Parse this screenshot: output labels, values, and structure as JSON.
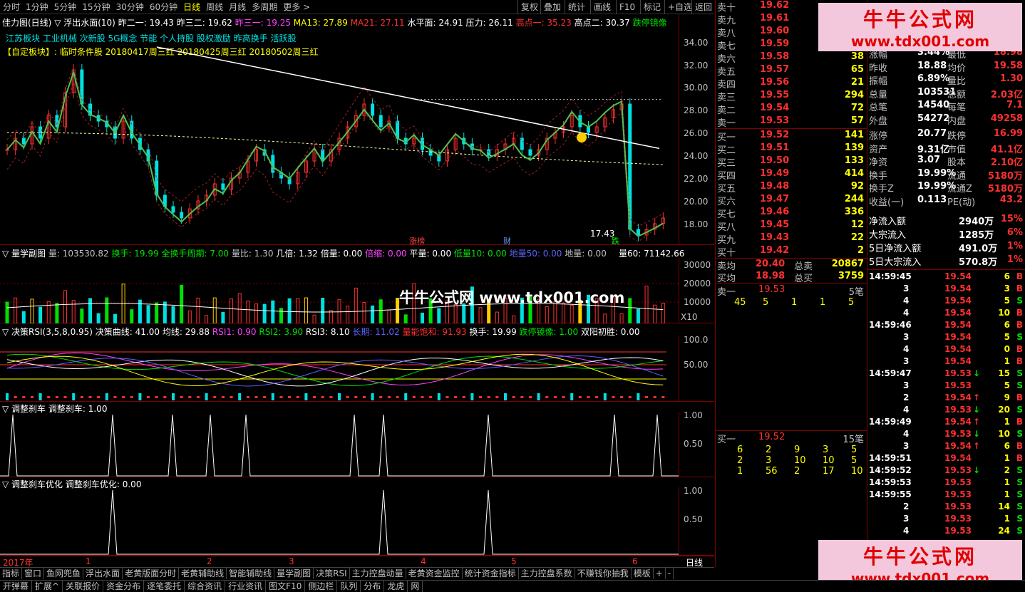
{
  "toolbar": {
    "periods": [
      "分时",
      "1分钟",
      "5分钟",
      "15分钟",
      "30分钟",
      "60分钟",
      "日线",
      "周线",
      "月线",
      "多周期",
      "更多 >"
    ],
    "buttons": [
      "复权",
      "叠加",
      "统计",
      "画线",
      "F10",
      "标记",
      "+自选",
      "返回"
    ]
  },
  "main": {
    "title": "佳力图(日线)",
    "indicator": "▽ 浮出水面(10)",
    "vals": [
      [
        "昨二一: 19.43",
        "wht"
      ],
      [
        "昨三二: 19.62",
        "wht"
      ],
      [
        "昨三一: 19.25",
        "mag"
      ],
      [
        "MA13: 27.89",
        "yel"
      ],
      [
        "MA21: 27.11",
        "red"
      ],
      [
        "水平面: 24.91",
        "wht"
      ],
      [
        "压力: 26.11",
        "wht"
      ],
      [
        "高点一: 35.23",
        "red"
      ],
      [
        "高点二: 30.37",
        "wht"
      ],
      [
        "跌停镜像",
        "grn"
      ]
    ],
    "blocks": "江苏板块 工业机械 次新股 5G概念 节能 个人持股 股权激励 昨高换手 活跃股",
    "custom": "【自定板块】: 临时条件股 20180417周三红 20180425周三红 20180502周三红",
    "yaxis": [
      "34.00",
      "32.00",
      "30.00",
      "28.00",
      "26.00",
      "24.00",
      "22.00",
      "20.00",
      "18.00"
    ],
    "low_label": "17.43",
    "tags": [
      "涨榜",
      "财",
      "跌"
    ]
  },
  "vol": {
    "title": "▽ 量学副图",
    "vals": [
      [
        "量: 103530.82",
        "gry"
      ],
      [
        "换手: 19.99",
        "grn"
      ],
      [
        "全换手周期: 7.00",
        "grn"
      ],
      [
        "量比: 1.30",
        "gry"
      ],
      [
        "几倍: 1.32",
        "wht"
      ],
      [
        "倍量: 0.00",
        "wht"
      ],
      [
        "倍缩: 0.00",
        "mag"
      ],
      [
        "平量: 0.00",
        "wht"
      ],
      [
        "低量10: 0.00",
        "grn"
      ],
      [
        "地量50: 0.00",
        "blu"
      ],
      [
        "地量: 0.00",
        "gry"
      ]
    ],
    "right": "量60: 71142.66",
    "yaxis": [
      "30000",
      "20000",
      "10000"
    ],
    "unit": "X10"
  },
  "rsi": {
    "title": "▽ 决策RSI(3,5,8,0.95)",
    "vals": [
      [
        "决策曲线: 41.00",
        "wht"
      ],
      [
        "均线: 29.88",
        "wht"
      ],
      [
        "RSI1: 0.90",
        "mag"
      ],
      [
        "RSI2: 3.90",
        "grn"
      ],
      [
        "RSI3: 8.10",
        "wht"
      ],
      [
        "长期: 11.02",
        "blu"
      ],
      [
        "量能饱和: 91.93",
        "red"
      ],
      [
        "换手: 19.99",
        "wht"
      ],
      [
        "跌停镜像: 1.00",
        "grn"
      ],
      [
        "双阳初胜: 0.00",
        "wht"
      ]
    ],
    "yaxis": [
      "100.0",
      "50.00"
    ]
  },
  "brake": {
    "title": "▽ 调整刹车",
    "label": "调整刹车: 1.00",
    "yaxis": [
      "1.00",
      "0.50"
    ]
  },
  "brake2": {
    "title": "▽ 调整刹车优化",
    "label": "调整刹车优化: 0.00",
    "yaxis": [
      "1.00",
      "0.50"
    ]
  },
  "xaxis": {
    "labels": [
      "2017年",
      "1",
      "2",
      "3",
      "4",
      "5",
      "6"
    ],
    "period": "日线"
  },
  "asks": [
    [
      "卖十",
      "19.62",
      ""
    ],
    [
      "卖九",
      "19.61",
      ""
    ],
    [
      "卖八",
      "19.60",
      ""
    ],
    [
      "卖七",
      "19.59",
      ""
    ],
    [
      "卖六",
      "19.58",
      "38"
    ],
    [
      "卖五",
      "19.57",
      "65"
    ],
    [
      "卖四",
      "19.56",
      "21"
    ],
    [
      "卖三",
      "19.55",
      "294"
    ],
    [
      "卖二",
      "19.54",
      "72"
    ],
    [
      "卖一",
      "19.53",
      "57"
    ]
  ],
  "bids": [
    [
      "买一",
      "19.52",
      "141"
    ],
    [
      "买二",
      "19.51",
      "139"
    ],
    [
      "买三",
      "19.50",
      "133"
    ],
    [
      "买四",
      "19.49",
      "414"
    ],
    [
      "买五",
      "19.48",
      "92"
    ],
    [
      "买六",
      "19.47",
      "244"
    ],
    [
      "买七",
      "19.46",
      "336"
    ],
    [
      "买八",
      "19.45",
      "12"
    ],
    [
      "买九",
      "19.43",
      "22"
    ],
    [
      "买十",
      "19.42",
      "2"
    ]
  ],
  "avg": [
    [
      "卖均",
      "20.40",
      "总卖",
      "20867"
    ],
    [
      "买均",
      "18.98",
      "总买",
      "3759"
    ]
  ],
  "queue_sell": {
    "label": "卖一",
    "price": "19.53",
    "count": "5笔",
    "orders": [
      "45",
      "5",
      "1",
      "1",
      "5"
    ]
  },
  "queue_buy": {
    "label": "买一",
    "price": "19.52",
    "count": "15笔",
    "orders": [
      [
        "6",
        "2",
        "9",
        "3",
        "5"
      ],
      [
        "2",
        "3",
        "10",
        "10",
        "5"
      ],
      [
        "1",
        "56",
        "2",
        "17",
        "10"
      ]
    ]
  },
  "stats": [
    [
      "涨幅",
      "3.44%",
      "最低",
      "18.98"
    ],
    [
      "昨收",
      "18.88",
      "均价",
      "19.58"
    ],
    [
      "振幅",
      "6.89%",
      "量比",
      "1.30"
    ],
    [
      "总量",
      "103531",
      "总额",
      "2.03亿"
    ],
    [
      "总笔",
      "14540",
      "每笔",
      "7.1"
    ],
    [
      "外盘",
      "54272",
      "内盘",
      "49258"
    ],
    [
      "涨停",
      "20.77",
      "跌停",
      "16.99"
    ],
    [
      "资产",
      "9.31亿",
      "市值",
      "41.1亿"
    ],
    [
      "净资",
      "3.07",
      "股本",
      "2.10亿"
    ],
    [
      "换手",
      "19.99%",
      "流通",
      "5180万"
    ],
    [
      "换手Z",
      "19.99%",
      "流通Z",
      "5180万"
    ],
    [
      "收益(一)",
      "0.113",
      "PE(动)",
      "43.2"
    ]
  ],
  "flows": [
    [
      "净流入额",
      "2940万",
      "15%"
    ],
    [
      "大宗流入",
      "1285万",
      "6%"
    ],
    [
      "5日净流入额",
      "491.0万",
      "1%"
    ],
    [
      "5日大宗流入",
      "570.8万",
      "1%"
    ]
  ],
  "ticks": [
    [
      "14:59:45",
      "19.54",
      "6",
      "B",
      ""
    ],
    [
      "3",
      "19.54",
      "3",
      "B",
      ""
    ],
    [
      "4",
      "19.54",
      "5",
      "S",
      ""
    ],
    [
      "4",
      "19.54",
      "10",
      "B",
      ""
    ],
    [
      "14:59:46",
      "19.54",
      "6",
      "B",
      ""
    ],
    [
      "3",
      "19.54",
      "5",
      "S",
      ""
    ],
    [
      "4",
      "19.54",
      "0",
      "B",
      ""
    ],
    [
      "3",
      "19.54",
      "1",
      "B",
      ""
    ],
    [
      "14:59:47",
      "19.53",
      "15",
      "S",
      "↓"
    ],
    [
      "3",
      "19.53",
      "5",
      "S",
      ""
    ],
    [
      "2",
      "19.54",
      "9",
      "B",
      "↑"
    ],
    [
      "4",
      "19.53",
      "20",
      "S",
      "↓"
    ],
    [
      "14:59:49",
      "19.54",
      "1",
      "B",
      "↑"
    ],
    [
      "4",
      "19.53",
      "10",
      "S",
      "↓"
    ],
    [
      "3",
      "19.54",
      "6",
      "B",
      "↑"
    ],
    [
      "14:59:51",
      "19.54",
      "1",
      "B",
      ""
    ],
    [
      "14:59:52",
      "19.53",
      "2",
      "S",
      "↓"
    ],
    [
      "14:59:53",
      "19.53",
      "1",
      "S",
      ""
    ],
    [
      "14:59:55",
      "19.53",
      "1",
      "S",
      ""
    ],
    [
      "2",
      "19.53",
      "14",
      "S",
      ""
    ],
    [
      "3",
      "19.53",
      "1",
      "S",
      ""
    ],
    [
      "4",
      "19.53",
      "24",
      "S",
      ""
    ]
  ],
  "bottom1": [
    "指标",
    "窗口",
    "鱼网兜鱼",
    "浮出水面",
    "老黄版面分时",
    "老黄辅助线",
    "智能辅助线",
    "量学副图",
    "决策RSI",
    "主力控盘动量",
    "老黄资金监控",
    "统计资金指标",
    "主力控盘系数",
    "不赚钱你抽我",
    "模板",
    "+",
    "-"
  ],
  "bottom2": [
    "开弹幕",
    "扩展^",
    "关联报价",
    "资金分布",
    "逐笔委托",
    "综合资讯",
    "行业资讯",
    "图文F10",
    "侧边栏",
    "队列",
    "分布",
    "龙虎",
    "网"
  ],
  "ad": {
    "name": "牛牛公式网",
    "url": "www.tdx001.com"
  },
  "watermark": "牛牛公式网 www.tdx001.com"
}
